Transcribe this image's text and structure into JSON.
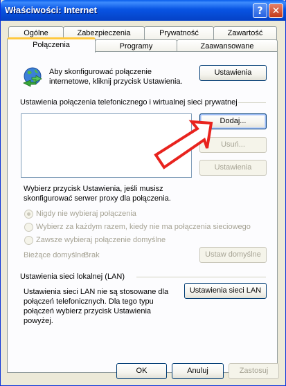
{
  "window": {
    "title": "Właściwości: Internet",
    "help_glyph": "?",
    "close_glyph": "✕"
  },
  "tabs_row1": [
    "Ogólne",
    "Zabezpieczenia",
    "Prywatność",
    "Zawartość"
  ],
  "tabs_row2": [
    "Połączenia",
    "Programy",
    "Zaawansowane"
  ],
  "active_tab": "Połączenia",
  "setup": {
    "text_line1": "Aby skonfigurować połączenie",
    "text_line2": "internetowe, kliknij przycisk Ustawienia.",
    "button": "Ustawienia"
  },
  "dialup": {
    "group_label": "Ustawienia połączenia telefonicznego i wirtualnej sieci prywatnej",
    "connections": [],
    "add_button": "Dodaj...",
    "remove_button": "Usuń...",
    "settings_button": "Ustawienia",
    "proxy_text_line1": "Wybierz przycisk Ustawienia, jeśli musisz",
    "proxy_text_line2": "skonfigurować serwer proxy dla połączenia.",
    "radio_never": "Nigdy nie wybieraj połączenia",
    "radio_whenever": "Wybierz za każdym razem, kiedy nie ma połączenia sieciowego",
    "radio_always": "Zawsze wybieraj połączenie domyślne",
    "selected_radio": "never",
    "current_default_label": "Bieżące domyślne:",
    "current_default_value": "Brak",
    "set_default_button": "Ustaw domyślne"
  },
  "lan": {
    "group_label": "Ustawienia sieci lokalnej (LAN)",
    "text_line1": "Ustawienia sieci LAN nie są stosowane dla",
    "text_line2": "połączeń telefonicznych. Dla tego typu",
    "text_line3": "połączeń wybierz przycisk Ustawienia",
    "text_line4": "powyżej.",
    "button": "Ustawienia sieci LAN"
  },
  "footer": {
    "ok": "OK",
    "cancel": "Anuluj",
    "apply": "Zastosuj"
  },
  "annotation": {
    "arrow_color": "#E8231E",
    "points_to": "add-button"
  },
  "colors": {
    "title_bar": "#0854E3",
    "dialog_bg": "#ECE9D8",
    "active_tab_accent": "#FFC83C"
  }
}
